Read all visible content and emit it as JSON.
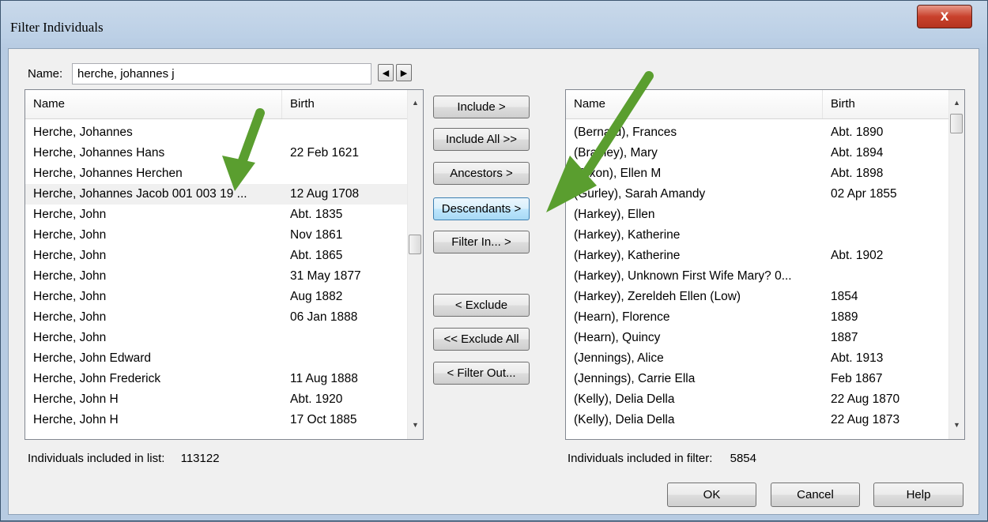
{
  "window": {
    "title": "Filter Individuals",
    "close_label": "x"
  },
  "name_field": {
    "label": "Name:",
    "value": "herche, johannes j"
  },
  "nav": {
    "prev": "◀",
    "next": "▶"
  },
  "left_list": {
    "columns": [
      "Name",
      "Birth"
    ],
    "rows": [
      {
        "name": "Herche, Johannes",
        "birth": ""
      },
      {
        "name": "Herche, Johannes Hans",
        "birth": "22 Feb 1621"
      },
      {
        "name": "Herche, Johannes Herchen",
        "birth": ""
      },
      {
        "name": "Herche, Johannes Jacob 001 003 19 ...",
        "birth": "12 Aug 1708"
      },
      {
        "name": "Herche, John",
        "birth": "Abt. 1835"
      },
      {
        "name": "Herche, John",
        "birth": "Nov 1861"
      },
      {
        "name": "Herche, John",
        "birth": "Abt. 1865"
      },
      {
        "name": "Herche, John",
        "birth": "31 May 1877"
      },
      {
        "name": "Herche, John",
        "birth": "Aug 1882"
      },
      {
        "name": "Herche, John",
        "birth": "06 Jan 1888"
      },
      {
        "name": "Herche, John",
        "birth": ""
      },
      {
        "name": "Herche, John Edward",
        "birth": ""
      },
      {
        "name": "Herche, John Frederick",
        "birth": "11 Aug 1888"
      },
      {
        "name": "Herche, John H",
        "birth": "Abt. 1920"
      },
      {
        "name": "Herche, John H",
        "birth": "17 Oct 1885"
      }
    ],
    "status_label": "Individuals included in list:",
    "status_count": "113122"
  },
  "middle_buttons": {
    "include": "Include >",
    "include_all": "Include All  >>",
    "ancestors": "Ancestors >",
    "descendants": "Descendants >",
    "filter_in": "Filter In... >",
    "exclude": "< Exclude",
    "exclude_all": "<< Exclude All",
    "filter_out": "< Filter Out..."
  },
  "right_list": {
    "columns": [
      "Name",
      "Birth"
    ],
    "rows": [
      {
        "name": "(Bernard), Frances",
        "birth": "Abt. 1890"
      },
      {
        "name": "(Bradley), Mary",
        "birth": "Abt. 1894"
      },
      {
        "name": "(Dixon), Ellen M",
        "birth": "Abt. 1898"
      },
      {
        "name": "(Gurley), Sarah Amandy",
        "birth": "02 Apr 1855"
      },
      {
        "name": "(Harkey), Ellen",
        "birth": ""
      },
      {
        "name": "(Harkey), Katherine",
        "birth": ""
      },
      {
        "name": "(Harkey), Katherine",
        "birth": "Abt. 1902"
      },
      {
        "name": "(Harkey), Unknown First Wife Mary? 0...",
        "birth": ""
      },
      {
        "name": "(Harkey), Zereldeh Ellen (Low)",
        "birth": "1854"
      },
      {
        "name": "(Hearn), Florence",
        "birth": "1889"
      },
      {
        "name": "(Hearn), Quincy",
        "birth": "1887"
      },
      {
        "name": "(Jennings), Alice",
        "birth": "Abt. 1913"
      },
      {
        "name": "(Jennings), Carrie Ella",
        "birth": "Feb 1867"
      },
      {
        "name": "(Kelly), Delia Della",
        "birth": "22 Aug 1870"
      },
      {
        "name": "(Kelly), Delia Della",
        "birth": "22 Aug 1873"
      }
    ],
    "status_label": "Individuals included in filter:",
    "status_count": "5854"
  },
  "footer": {
    "ok": "OK",
    "cancel": "Cancel",
    "help": "Help"
  },
  "colors": {
    "annotation_arrow": "#5a9e2f",
    "title_close": "#c9412c"
  }
}
